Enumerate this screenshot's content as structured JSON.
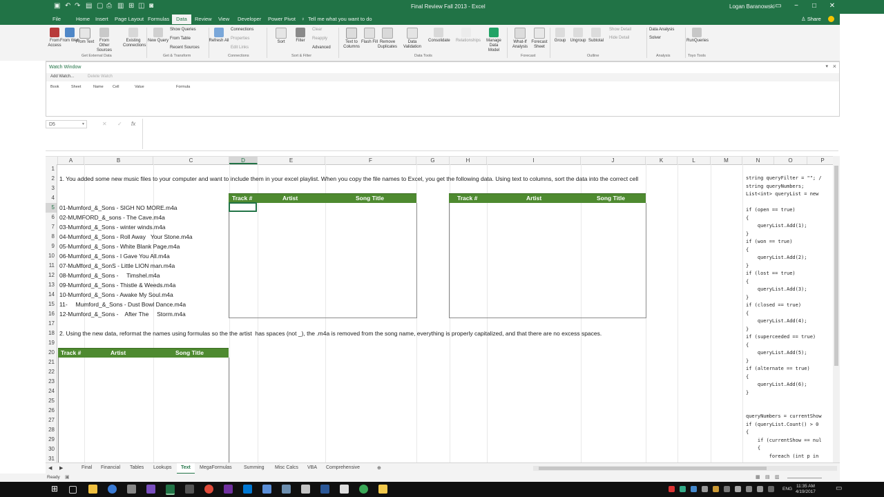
{
  "app": {
    "title": "Final Review Fall 2013 - Excel",
    "user": "Logan Baranowski",
    "accent": "#217346"
  },
  "title_bar": {
    "quick_access": [
      "save-icon",
      "undo-icon",
      "redo-icon"
    ],
    "window_buttons": [
      "−",
      "□",
      "✕"
    ]
  },
  "ribbon_tabs": [
    "File",
    "Home",
    "Insert",
    "Page Layout",
    "Formulas",
    "Data",
    "Review",
    "View",
    "Developer",
    "Power Pivot"
  ],
  "active_tab": "Data",
  "tell_me": "Tell me what you want to do",
  "share": "Share",
  "ribbon": {
    "get_external": [
      "From Access",
      "From Web",
      "From Text",
      "From Other Sources",
      "Existing Connections"
    ],
    "new_query": "New Query",
    "show_queries": "Show Queries",
    "from_table": "From Table",
    "recent_sources": "Recent Sources",
    "refresh_all": "Refresh All",
    "connections": "Connections",
    "properties": "Properties",
    "edit_links": "Edit Links",
    "sort": "Sort",
    "filter": "Filter",
    "clear": "Clear",
    "reapply": "Reapply",
    "advanced": "Advanced",
    "data_tools": [
      "Text to Columns",
      "Flash Fill",
      "Remove Duplicates",
      "Data Validation",
      "Consolidate",
      "Relationships",
      "Manage Data Model"
    ],
    "forecast": [
      "What-If Analysis",
      "Forecast Sheet"
    ],
    "outline": [
      "Group",
      "Ungroup",
      "Subtotal"
    ],
    "show_detail": "Show Detail",
    "hide_detail": "Hide Detail",
    "data_analysis": "Data Analysis",
    "solver": "Solver",
    "run_queries": "RunQueries",
    "groups": [
      "Get External Data",
      "Get & Transform",
      "Connections",
      "Sort & Filter",
      "Data Tools",
      "Forecast",
      "Outline",
      "Analysis",
      "Toyo Tools"
    ]
  },
  "watch_window": {
    "title": "Watch Window",
    "add": "Add Watch...",
    "delete": "Delete Watch",
    "columns": [
      "Book",
      "Sheet",
      "Name",
      "Cell",
      "Value",
      "Formula"
    ]
  },
  "formula_bar": {
    "name_box": "D5",
    "fx": "fx",
    "value": ""
  },
  "columns": [
    "A",
    "B",
    "C",
    "D",
    "E",
    "F",
    "G",
    "H",
    "I",
    "J",
    "K",
    "L",
    "M",
    "N",
    "O",
    "P"
  ],
  "rows": [
    "1",
    "2",
    "3",
    "4",
    "5",
    "6",
    "7",
    "8",
    "9",
    "10",
    "11",
    "12",
    "13",
    "14",
    "15",
    "16",
    "17",
    "18",
    "19",
    "20",
    "21",
    "22",
    "23",
    "24",
    "25",
    "26",
    "27",
    "28",
    "29",
    "30",
    "31"
  ],
  "sheet": {
    "instruction1": "1. You added some new music files to your computer and want to include them in your excel playlist. When you copy the file names to Excel, you get the following data. Using text to columns, sort the data into the correct cell",
    "files": [
      "01-Mumford_&_Sons - SIGH NO MORE.m4a",
      "02-MUMFORD_&_sons - The Cave.m4a",
      "03-Mumford_&_Sons - winter winds.m4a",
      "04-Mumford_&_Sons - Roll Away   Your Stone.m4a",
      "05-Mumford_&_Sons - White Blank Page.m4a",
      "06-Mumford_&_Sons - I Gave You All.m4a",
      "07-MuMford_&_SonS - Little LION man.m4a",
      "08-Mumford_&_Sons -     Timshel.m4a",
      "09-Mumford_&_Sons - Thistle & Weeds.m4a",
      "10-Mumford_&_Sons - Awake My Soul.m4a",
      "11-     Mumford_&_Sons - Dust Bowl Dance.m4a",
      "12-Mumford_&_Sons -    After The     Storm.m4a"
    ],
    "table_headers": [
      "Track #",
      "Artist",
      "Song Title"
    ],
    "instruction2": "2. Using the new data, reformat the names using formulas so the the artist  has spaces (not _), the .m4a is removed from the song name, everything is properly capitalized, and that there are no excess spaces.",
    "header_green": "#4e8a30"
  },
  "code_panel": {
    "lines": [
      "string queryFilter = \"\"; /",
      "string queryNumbers;",
      "List<int> queryList = new",
      "",
      "if (open == true)",
      "{",
      "    queryList.Add(1);",
      "}",
      "if (won == true)",
      "{",
      "    queryList.Add(2);",
      "}",
      "if (lost == true)",
      "{",
      "    queryList.Add(3);",
      "}",
      "if (closed == true)",
      "{",
      "    queryList.Add(4);",
      "}",
      "if (superceeded == true)",
      "{",
      "    queryList.Add(5);",
      "}",
      "if (alternate == true)",
      "{",
      "    queryList.Add(6);",
      "}",
      "",
      "",
      "queryNumbers = currentShow",
      "if (queryList.Count() > 0",
      "{",
      "    if (currentShow == nul",
      "    {",
      "        foreach (int p in"
    ]
  },
  "sheet_tabs": [
    "Final",
    "Financial",
    "Tables",
    "Lookups",
    "Text",
    "MegaFormulas",
    "Summing",
    "Misc Calcs",
    "VBA",
    "Comprehensive"
  ],
  "active_sheet": "Text",
  "status": {
    "ready": "Ready"
  },
  "taskbar": {
    "lang": "ENG",
    "time": "11:35 AM",
    "date": "4/19/2017"
  }
}
